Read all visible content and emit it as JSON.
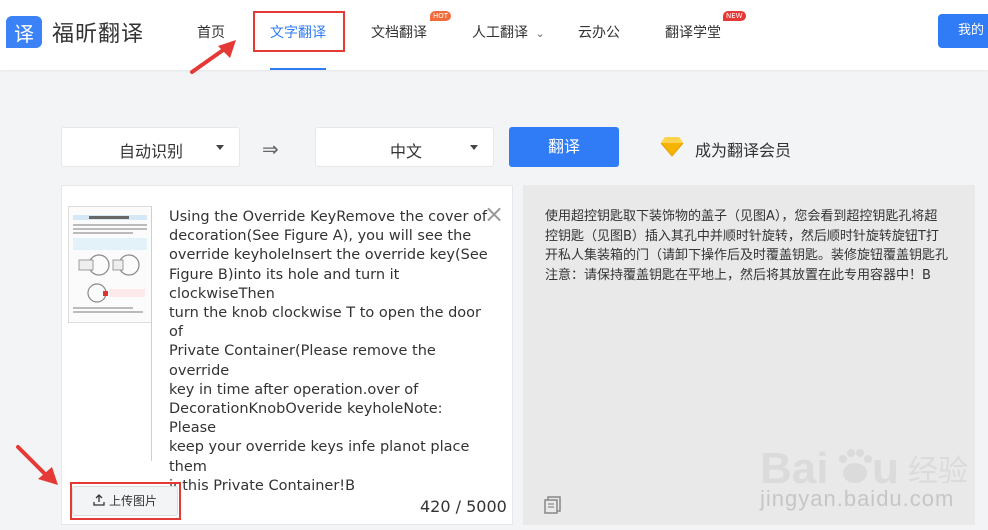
{
  "brand": {
    "logo_char": "译",
    "name": "福昕翻译"
  },
  "nav": {
    "home": "首页",
    "text_translate": "文字翻译",
    "doc_translate": "文档翻译",
    "doc_badge": "HOT",
    "human_translate": "人工翻译",
    "human_caret": "⌄",
    "cloud_office": "云办公",
    "academy": "翻译学堂",
    "academy_badge": "NEW",
    "my_button": "我的"
  },
  "toolbar": {
    "source_lang": "自动识别",
    "swap_icon": "⇒",
    "target_lang": "中文",
    "translate_label": "翻译",
    "vip_label": "成为翻译会员"
  },
  "source": {
    "text": "Using the Override KeyRemove the cover of\ndecoration(See Figure A), you will see the\noverride keyholeInsert the override key(See\nFigure B)into its hole and turn it clockwiseThen\nturn the knob clockwise T to open the door of\nPrivate Container(Please remove the override\nkey in time after operation.over of\nDecorationKnobOveride keyholeNote: Please\nkeep your override keys infe planot place them\ninthis Private Container!B",
    "close_icon": "×",
    "upload_label": "上传图片",
    "count_current": "420",
    "count_sep": " / ",
    "count_max": "5000"
  },
  "result": {
    "text": "使用超控钥匙取下装饰物的盖子（见图A），您会看到超控钥匙孔将超控钥匙（见图B）插入其孔中并顺时针旋转，然后顺时针旋转旋钮T打开私人集装箱的门（请卸下操作后及时覆盖钥匙。装修旋钮覆盖钥匙孔注意：请保持覆盖钥匙在平地上，然后将其放置在此专用容器中！B"
  },
  "watermark": {
    "text": "jingyan.baidu.com"
  },
  "colors": {
    "accent": "#2f7cf6",
    "annotation": "#e53935",
    "vip": "#f5b400"
  }
}
